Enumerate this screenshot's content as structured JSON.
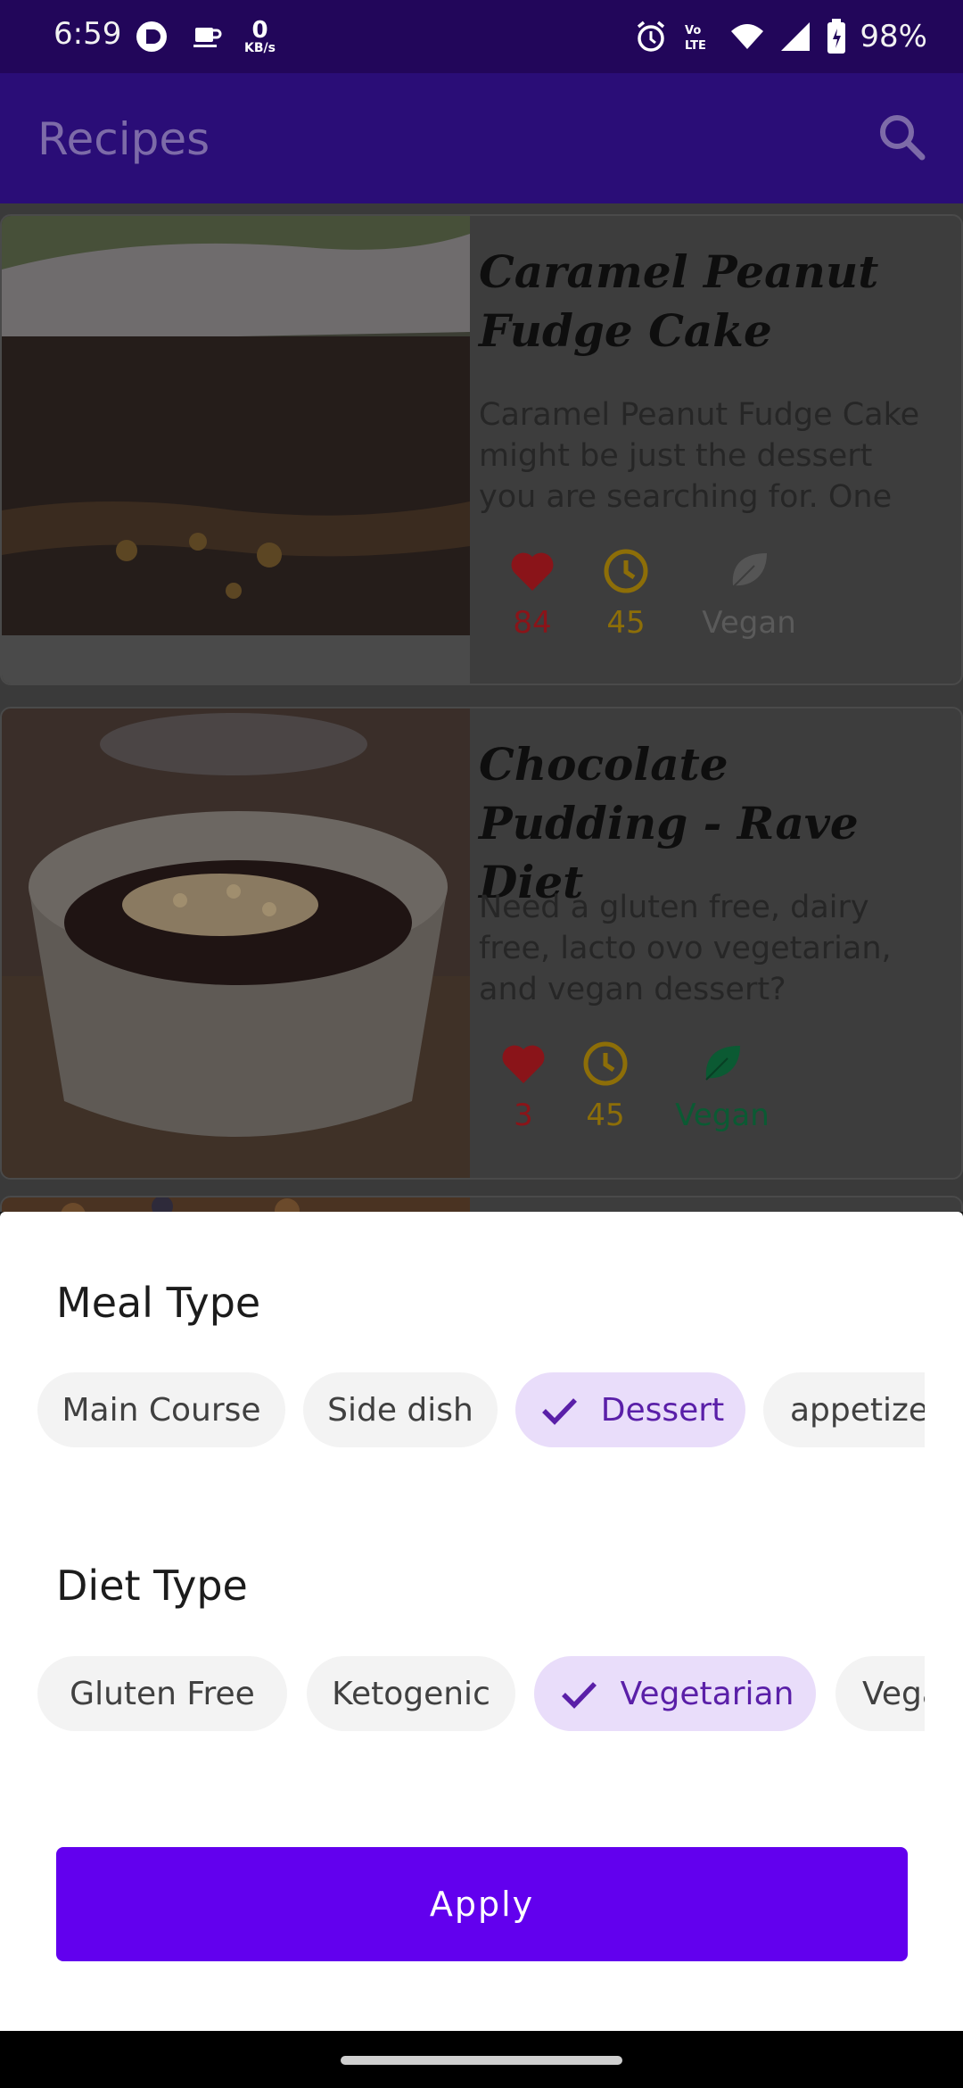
{
  "status_bar": {
    "time": "6:59",
    "net_speed_value": "0",
    "net_speed_unit": "KB/s",
    "battery": "98%",
    "icons": [
      "notification-app-icon",
      "coffee-icon",
      "alarm-icon",
      "volte-icon",
      "wifi-icon",
      "signal-icon",
      "battery-icon"
    ]
  },
  "app_bar": {
    "title": "Recipes",
    "search_icon": "search-icon"
  },
  "recipes": [
    {
      "title": "Caramel Peanut Fudge Cake",
      "description": "Caramel Peanut Fudge Cake might be just the dessert you are searching for. One p...",
      "likes": "84",
      "minutes": "45",
      "vegan_label": "Vegan",
      "is_vegan": false
    },
    {
      "title": "Chocolate Pudding - Rave Diet",
      "description": "Need a gluten free, dairy free, lacto ovo vegetarian, and vegan dessert? Chocolate P...",
      "likes": "3",
      "minutes": "45",
      "vegan_label": "Vegan",
      "is_vegan": true
    }
  ],
  "sheet": {
    "meal_type_title": "Meal Type",
    "meal_types": [
      "Main Course",
      "Side dish",
      "Dessert",
      "appetizer"
    ],
    "meal_type_selected": "Dessert",
    "diet_type_title": "Diet Type",
    "diet_types": [
      "Gluten Free",
      "Ketogenic",
      "Vegetarian",
      "Vegan"
    ],
    "diet_type_selected": "Vegetarian",
    "apply_label": "Apply"
  },
  "colors": {
    "primary": "#6200ee",
    "heart": "#b3161d",
    "clock": "#b08a08",
    "vegan_active": "#0b6e3e",
    "vegan_inactive": "#5a5a5a",
    "chip_selected_bg": "#e9ddfa"
  }
}
